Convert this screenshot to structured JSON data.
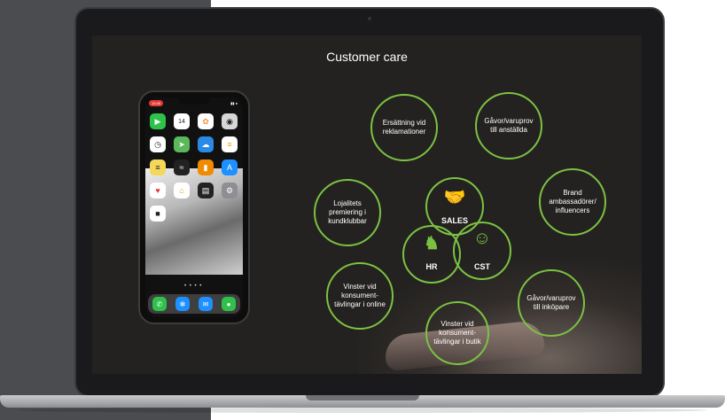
{
  "slide": {
    "title": "Customer care"
  },
  "phone": {
    "time": "10:45",
    "status": "▮▮ ●",
    "page_dots": "• • • •"
  },
  "circles": {
    "ersattning": "Ersättning vid reklamationer",
    "gavor_anstallda": "Gåvor/varuprov till anställda",
    "lojalitets": "Lojalitets premiering i kundklubbar",
    "brand": "Brand ambassadörer/ influencers",
    "vinster_online": "Vinster vid konsument-tävlingar i online",
    "vinster_butik": "Vinster vid konsument-tävlingar i butik",
    "gavor_inkopare": "Gåvor/varuprov till inköpare"
  },
  "core": {
    "sales": "SALES",
    "hr": "HR",
    "cst": "CST"
  },
  "colors": {
    "accent": "#7cc242",
    "slide_bg": "#232220",
    "left_panel": "#4a4c50"
  }
}
